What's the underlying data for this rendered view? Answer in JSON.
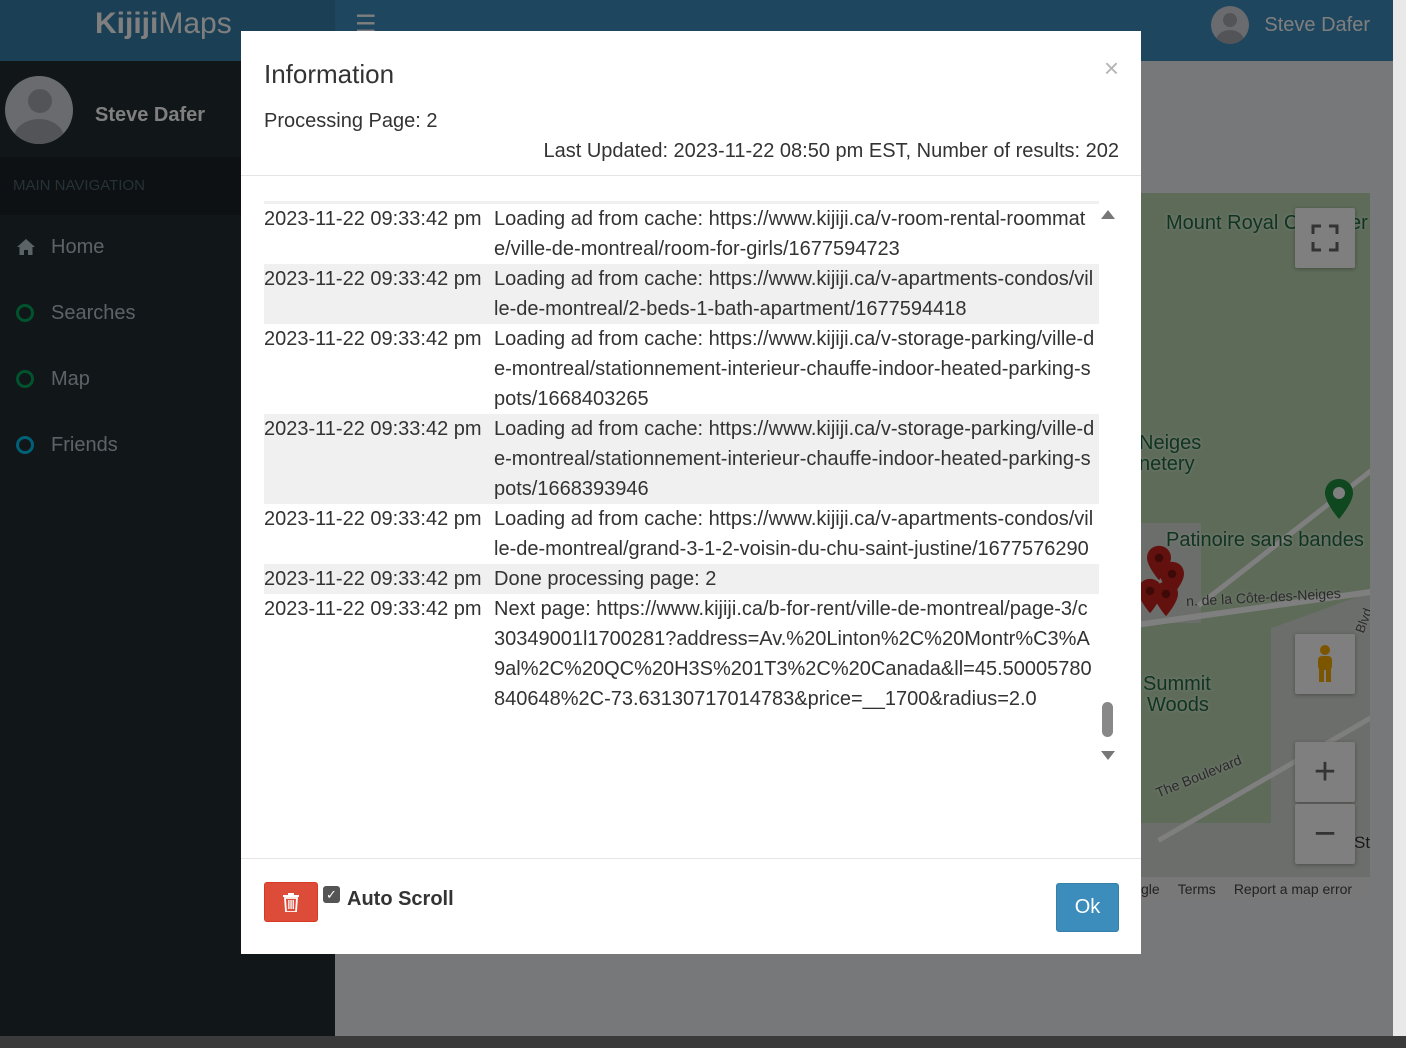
{
  "app": {
    "logo_bold": "Kijiji",
    "logo_rest": "Maps",
    "user_name": "Steve Dafer"
  },
  "sidebar": {
    "user_name": "Steve Dafer",
    "header": "MAIN NAVIGATION",
    "items": [
      {
        "label": "Home",
        "icon": "home-icon"
      },
      {
        "label": "Searches",
        "icon": "circle-icon",
        "color": "#00a65a"
      },
      {
        "label": "Map",
        "icon": "circle-icon",
        "color": "#00a65a"
      },
      {
        "label": "Friends",
        "icon": "circle-icon",
        "color": "#00c0ef"
      }
    ]
  },
  "map": {
    "labels": [
      "Mount Royal C",
      "er",
      "Neiges",
      "netery",
      "Patinoire sans bandes",
      "n. de la Côte-des-Neiges",
      "Summit",
      "Woods",
      "The Boulevard",
      "Blvd",
      "St"
    ],
    "footer": [
      "gle",
      "Terms",
      "Report a map error"
    ]
  },
  "modal": {
    "title": "Information",
    "close": "×",
    "processing": "Processing Page: 2",
    "last_updated": "Last Updated: 2023-11-22 08:50 pm EST, Number of results: 202",
    "log": [
      {
        "time": "2023-11-22 09:33:42 pm",
        "message": "Loading ad from cache: https://www.kijiji.ca/v-room-rental-roommate/ville-de-montreal/room-for-girls/1677594723"
      },
      {
        "time": "2023-11-22 09:33:42 pm",
        "message": "Loading ad from cache: https://www.kijiji.ca/v-apartments-condos/ville-de-montreal/2-beds-1-bath-apartment/1677594418"
      },
      {
        "time": "2023-11-22 09:33:42 pm",
        "message": "Loading ad from cache: https://www.kijiji.ca/v-storage-parking/ville-de-montreal/stationnement-interieur-chauffe-indoor-heated-parking-spots/1668403265"
      },
      {
        "time": "2023-11-22 09:33:42 pm",
        "message": "Loading ad from cache: https://www.kijiji.ca/v-storage-parking/ville-de-montreal/stationnement-interieur-chauffe-indoor-heated-parking-spots/1668393946"
      },
      {
        "time": "2023-11-22 09:33:42 pm",
        "message": "Loading ad from cache: https://www.kijiji.ca/v-apartments-condos/ville-de-montreal/grand-3-1-2-voisin-du-chu-saint-justine/1677576290"
      },
      {
        "time": "2023-11-22 09:33:42 pm",
        "message": "Done processing page: 2"
      },
      {
        "time": "2023-11-22 09:33:42 pm",
        "message": "Next page: https://www.kijiji.ca/b-for-rent/ville-de-montreal/page-3/c30349001l1700281?address=Av.%20Linton%2C%20Montr%C3%A9al%2C%20QC%20H3S%201T3%2C%20Canada&ll=45.50005780840648%2C-73.63130717014783&price=__1700&radius=2.0"
      }
    ],
    "autoscroll_label": "Auto Scroll",
    "autoscroll_checked": true,
    "ok_label": "Ok"
  },
  "colors": {
    "header": "#3c8dbc",
    "sidebar": "#222d32",
    "delete": "#dd4b39",
    "ok": "#3c8dbc"
  }
}
